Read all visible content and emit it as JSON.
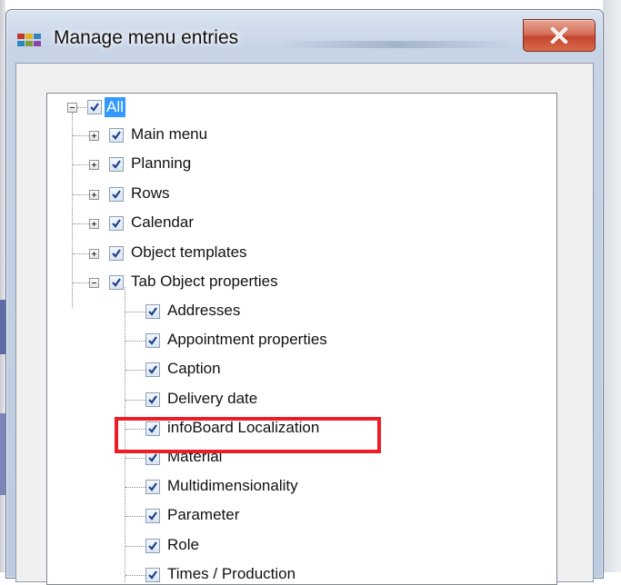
{
  "window": {
    "title": "Manage menu entries",
    "close_icon": "close-icon",
    "app_icon": "app-icon"
  },
  "tree": {
    "root": {
      "label": "All",
      "checked": true,
      "expanded": true,
      "selected": true
    },
    "items": [
      {
        "label": "Main menu",
        "checked": true,
        "expanded": false
      },
      {
        "label": "Planning",
        "checked": true,
        "expanded": false
      },
      {
        "label": "Rows",
        "checked": true,
        "expanded": false
      },
      {
        "label": "Calendar",
        "checked": true,
        "expanded": false
      },
      {
        "label": "Object templates",
        "checked": true,
        "expanded": false
      },
      {
        "label": "Tab Object properties",
        "checked": true,
        "expanded": true
      }
    ],
    "subitems": [
      {
        "label": "Addresses",
        "checked": true
      },
      {
        "label": "Appointment properties",
        "checked": true
      },
      {
        "label": "Caption",
        "checked": true
      },
      {
        "label": "Delivery date",
        "checked": true
      },
      {
        "label": "infoBoard Localization",
        "checked": true,
        "highlighted": true
      },
      {
        "label": "Material",
        "checked": true
      },
      {
        "label": "Multidimensionality",
        "checked": true
      },
      {
        "label": "Parameter",
        "checked": true
      },
      {
        "label": "Role",
        "checked": true
      },
      {
        "label": "Times / Production",
        "checked": true
      }
    ]
  },
  "colors": {
    "selection": "#3399ff",
    "highlight_box": "#ee1c24",
    "checkmark": "#1c3f8c"
  }
}
